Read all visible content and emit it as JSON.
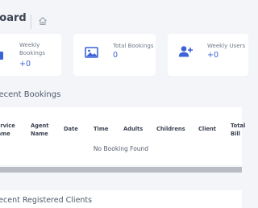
{
  "header": {
    "title": "board"
  },
  "cards": [
    {
      "label_line1": "Weekly",
      "label_line2": "Bookings",
      "value": "+0",
      "icon": "calendar-icon"
    },
    {
      "label_line1": "Total Bookings",
      "value": "0",
      "icon": "image-icon"
    },
    {
      "label_line1": "Weekly Users",
      "value": "+0",
      "icon": "add-user-icon"
    }
  ],
  "colors": {
    "accent": "#3d63d8",
    "background": "#f3f5f9",
    "card": "#ffffff"
  },
  "recent_bookings": {
    "title": "Recent Bookings",
    "columns": [
      [
        "Service",
        "Name"
      ],
      [
        "Agent",
        "Name"
      ],
      [
        "Date"
      ],
      [
        "Time"
      ],
      [
        "Adults"
      ],
      [
        "Childrens"
      ],
      [
        "Client"
      ],
      [
        "Total",
        "Bill"
      ]
    ],
    "empty_message": "No Booking Found"
  },
  "recent_clients": {
    "title": "Recent Registered Clients"
  }
}
